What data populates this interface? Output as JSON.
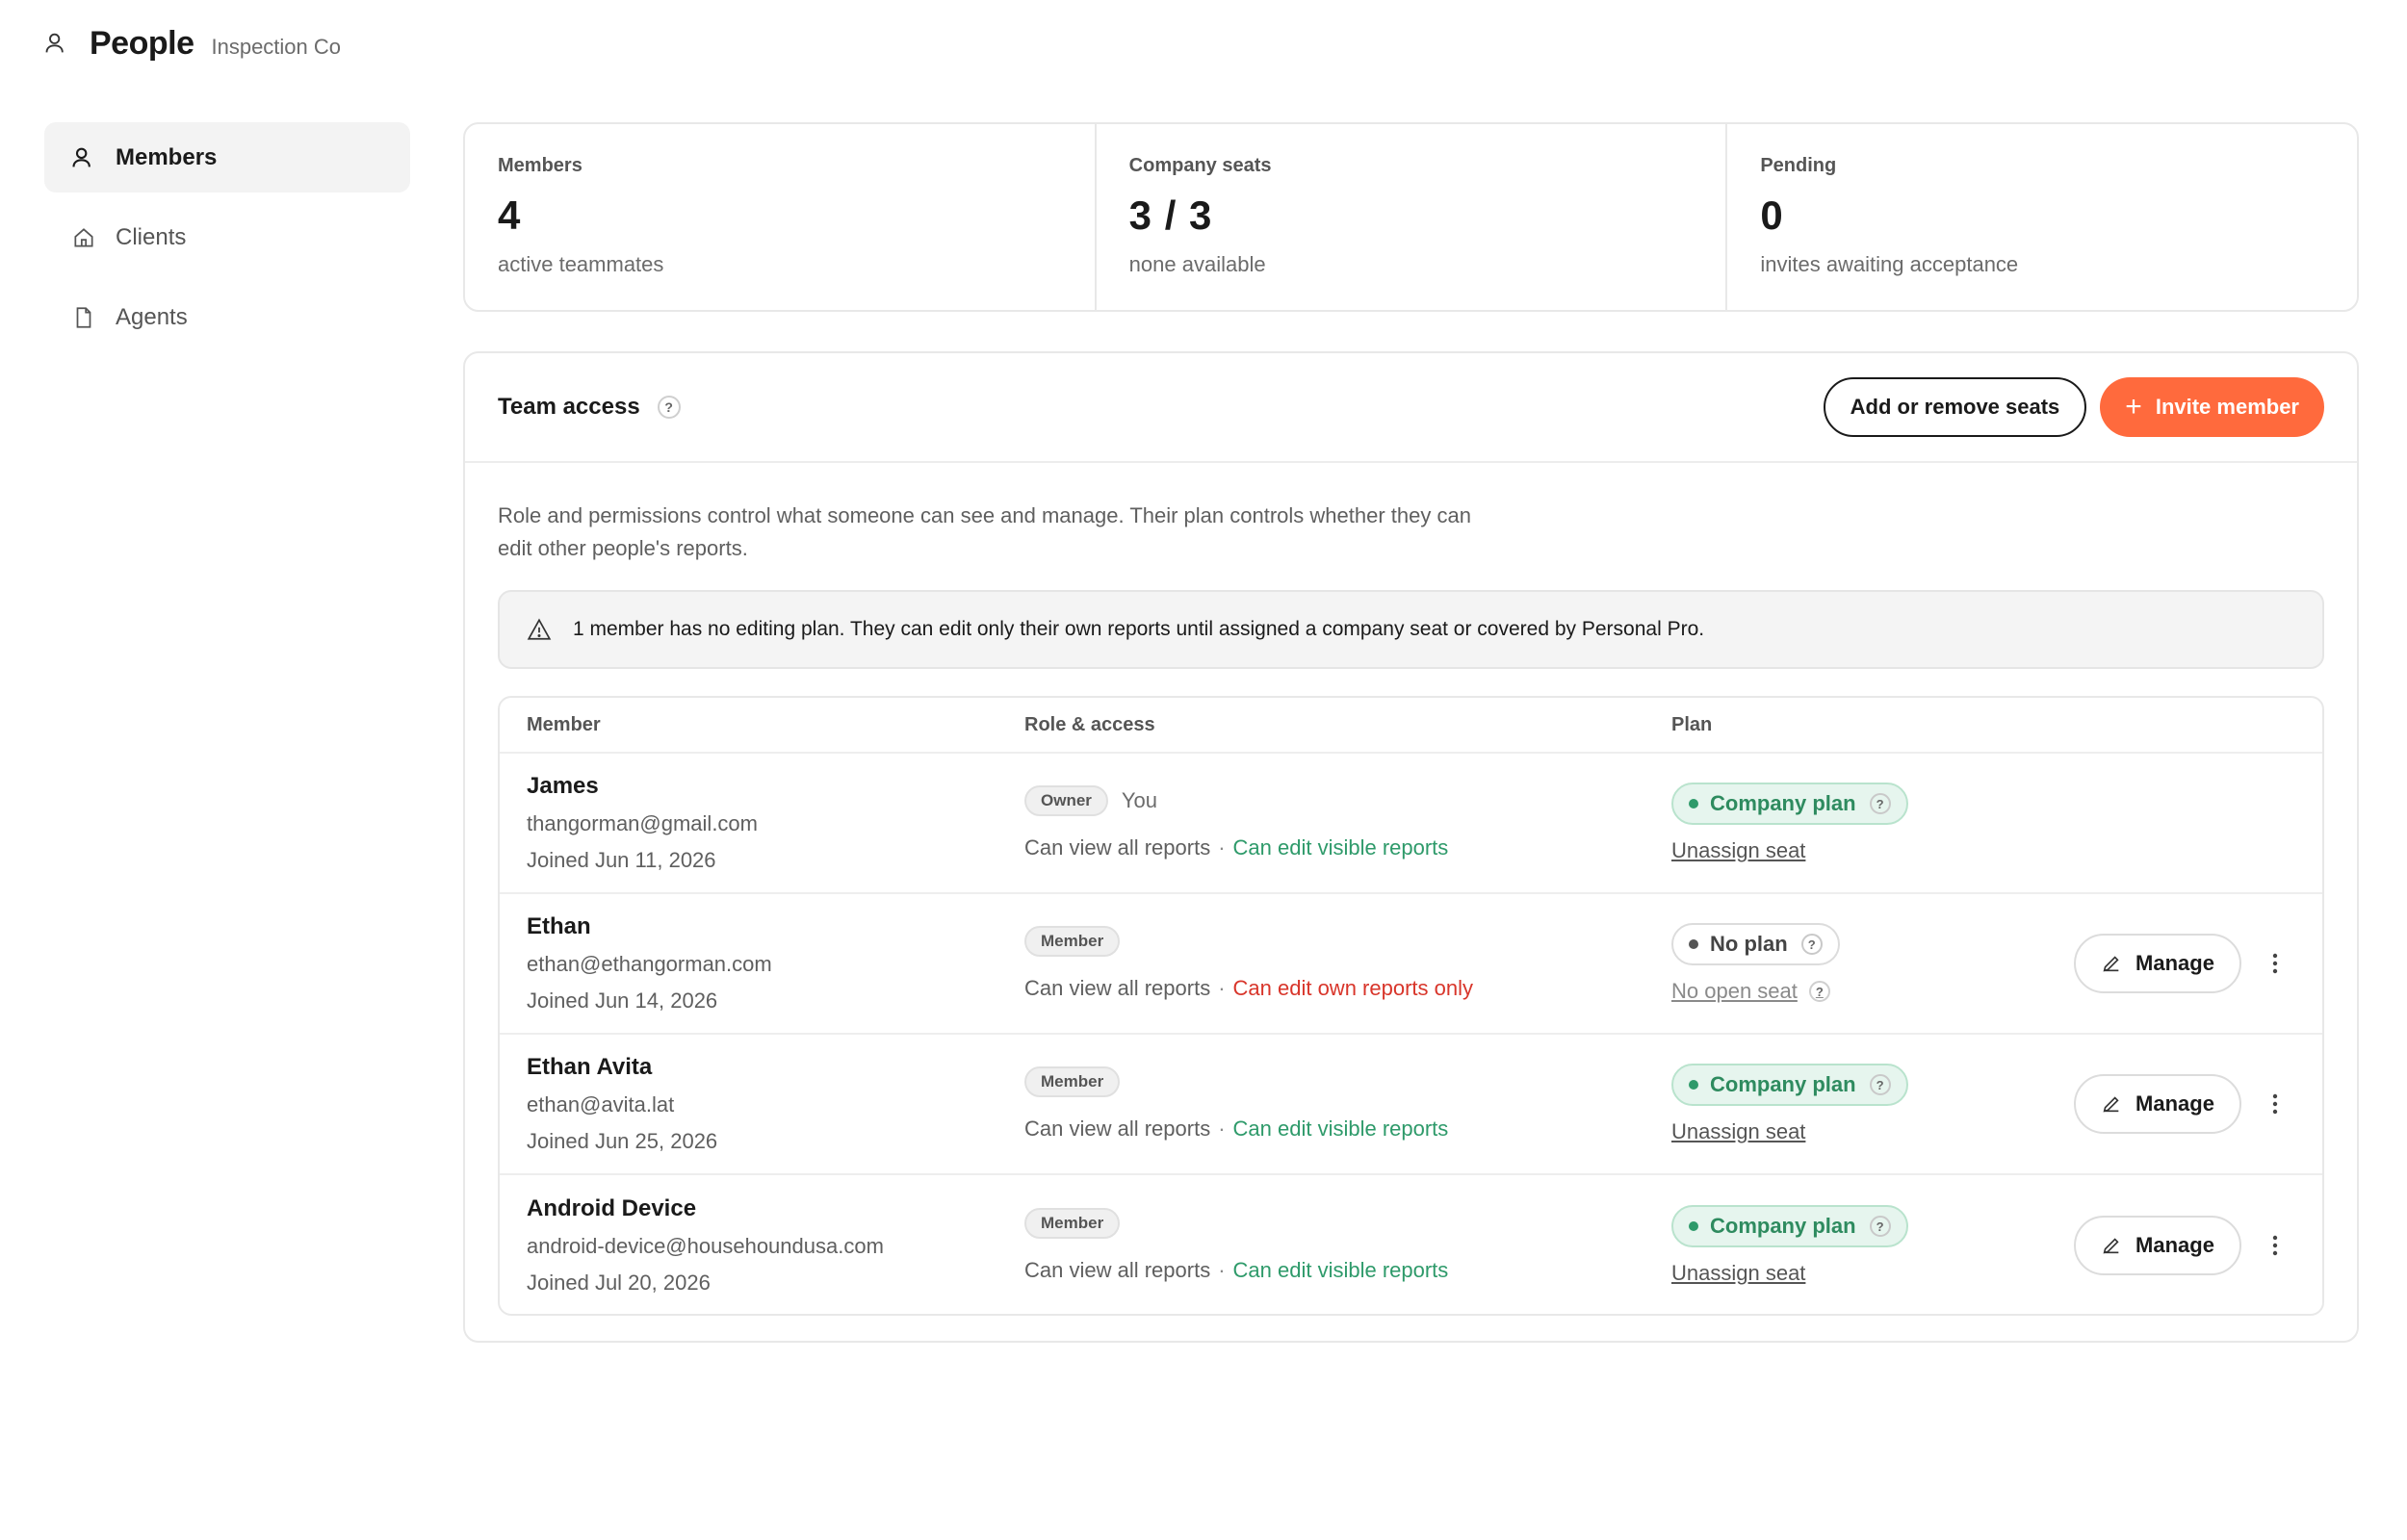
{
  "header": {
    "title": "People",
    "org": "Inspection Co",
    "icon": "person-icon"
  },
  "sidebar": {
    "items": [
      {
        "label": "Members",
        "icon": "person-icon",
        "active": true
      },
      {
        "label": "Clients",
        "icon": "home-icon",
        "active": false
      },
      {
        "label": "Agents",
        "icon": "document-icon",
        "active": false
      }
    ]
  },
  "stats": [
    {
      "label": "Members",
      "value": "4",
      "sub": "active teammates"
    },
    {
      "label": "Company seats",
      "value": "3 / 3",
      "sub": "none available"
    },
    {
      "label": "Pending",
      "value": "0",
      "sub": "invites awaiting acceptance"
    }
  ],
  "team": {
    "title": "Team access",
    "help": "?",
    "add_remove_label": "Add or remove seats",
    "invite_label": "Invite member",
    "description": "Role and permissions control what someone can see and manage. Their plan controls whether they can edit other people's reports.",
    "warning": "1 member has no editing plan. They can edit only their own reports until assigned a company seat or covered by Personal Pro."
  },
  "table": {
    "headers": {
      "member": "Member",
      "role": "Role & access",
      "plan": "Plan"
    },
    "dot": "·",
    "rows": [
      {
        "name": "James",
        "email": "thangorman@gmail.com",
        "joined": "Joined Jun 11, 2026",
        "role": "Owner",
        "you": "You",
        "view": "Can view all reports",
        "edit": "Can edit visible reports",
        "plan": "Company plan",
        "plan_link": "Unassign seat",
        "manage": ""
      },
      {
        "name": "Ethan",
        "email": "ethan@ethangorman.com",
        "joined": "Joined Jun 14, 2026",
        "role": "Member",
        "you": "",
        "view": "Can view all reports",
        "edit": "Can edit own reports only",
        "plan": "No plan",
        "plan_link": "No open seat",
        "manage": "Manage"
      },
      {
        "name": "Ethan Avita",
        "email": "ethan@avita.lat",
        "joined": "Joined Jun 25, 2026",
        "role": "Member",
        "you": "",
        "view": "Can view all reports",
        "edit": "Can edit visible reports",
        "plan": "Company plan",
        "plan_link": "Unassign seat",
        "manage": "Manage"
      },
      {
        "name": "Android Device",
        "email": "android-device@househoundusa.com",
        "joined": "Joined Jul 20, 2026",
        "role": "Member",
        "you": "",
        "view": "Can view all reports",
        "edit": "Can edit visible reports",
        "plan": "Company plan",
        "plan_link": "Unassign seat",
        "manage": "Manage"
      }
    ]
  },
  "colors": {
    "accent": "#ff6a3d",
    "green": "#2e9a6a",
    "red": "#d8352a"
  }
}
